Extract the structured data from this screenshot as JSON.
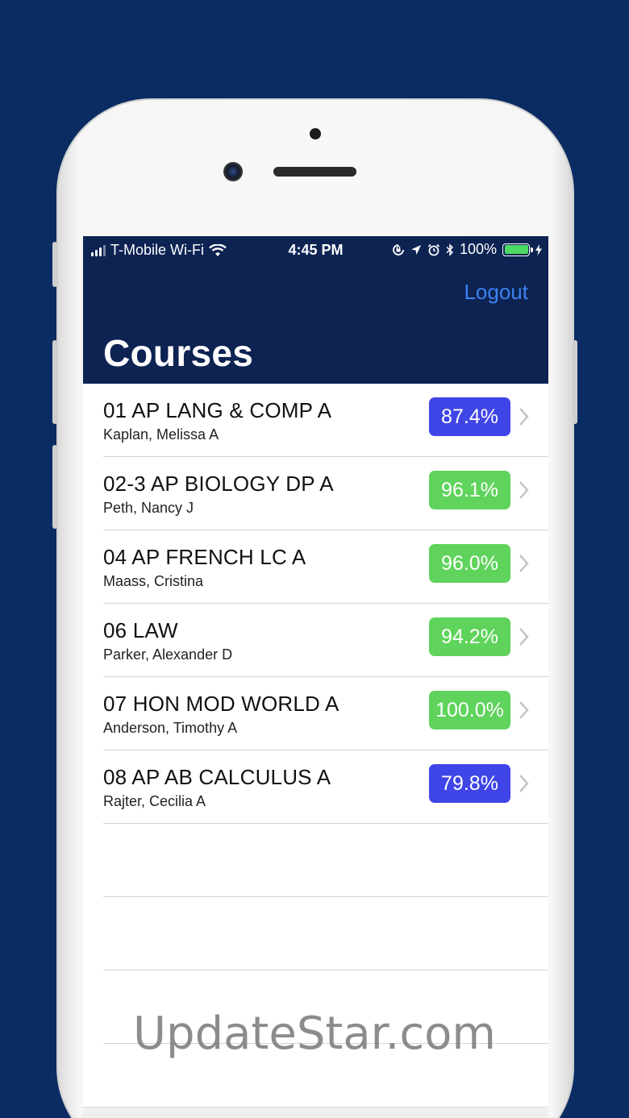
{
  "status_bar": {
    "carrier": "T-Mobile Wi-Fi",
    "time": "4:45 PM",
    "battery_percent_label": "100%",
    "battery_level": 1.0,
    "icons": [
      "signal-icon",
      "wifi-icon",
      "rotation-lock-icon",
      "location-icon",
      "alarm-icon",
      "bluetooth-icon",
      "battery-icon",
      "charging-icon"
    ]
  },
  "nav": {
    "logout_label": "Logout",
    "title": "Courses"
  },
  "colors": {
    "background": "#0a2c63",
    "navbar": "#0d2352",
    "link": "#3b82f0",
    "grade_blue": "#3f45e6",
    "grade_green": "#5fd35b"
  },
  "courses": [
    {
      "name": "01 AP LANG & COMP A",
      "teacher": "Kaplan, Melissa A",
      "grade": "87.4%",
      "grade_color": "#3f45e6"
    },
    {
      "name": "02-3 AP BIOLOGY DP A",
      "teacher": "Peth, Nancy J",
      "grade": "96.1%",
      "grade_color": "#5fd35b"
    },
    {
      "name": "04 AP FRENCH LC A",
      "teacher": "Maass, Cristina",
      "grade": "96.0%",
      "grade_color": "#5fd35b"
    },
    {
      "name": "06 LAW",
      "teacher": "Parker, Alexander D",
      "grade": "94.2%",
      "grade_color": "#5fd35b"
    },
    {
      "name": "07 HON MOD WORLD A",
      "teacher": "Anderson, Timothy A",
      "grade": "100.0%",
      "grade_color": "#5fd35b"
    },
    {
      "name": "08 AP AB CALCULUS A",
      "teacher": "Rajter, Cecilia A",
      "grade": "79.8%",
      "grade_color": "#3f45e6"
    }
  ],
  "watermark": "UpdateStar.com"
}
